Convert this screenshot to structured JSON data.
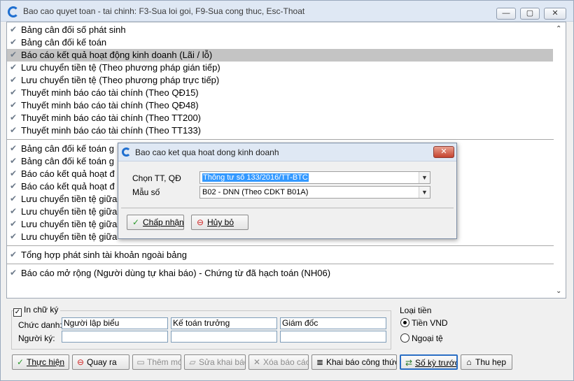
{
  "window": {
    "title": "Bao cao quyet toan - tai chinh: F3-Sua loi goi, F9-Sua cong thuc, Esc-Thoat",
    "min_icon": "minimize-icon",
    "max_icon": "maximize-icon",
    "close_icon": "close-icon"
  },
  "report_list": {
    "group1": [
      "Bảng cân đối số phát sinh",
      "Bảng cân đối kế toán",
      "Báo cáo kết quả hoạt động kinh doanh (Lãi / lỗ)",
      "Lưu chuyển tiền tệ (Theo phương pháp gián tiếp)",
      "Lưu chuyển tiền tệ (Theo phương pháp trực tiếp)",
      "Thuyết minh báo cáo tài chính (Theo QĐ15)",
      "Thuyết minh báo cáo tài chính (Theo QĐ48)",
      "Thuyết minh báo cáo tài chính (Theo TT200)",
      "Thuyết minh báo cáo tài chính (Theo TT133)"
    ],
    "group2": [
      "Bảng cân đối kế toán g",
      "Bảng cân đối kế toán g",
      "Báo cáo kết quả hoạt đ",
      "Báo cáo kết quả hoạt đ",
      "Lưu chuyển tiền tệ giữa",
      "Lưu chuyển tiền tệ giữa",
      "Lưu chuyển tiền tệ giữa",
      "Lưu chuyển tiền tệ giữa"
    ],
    "group3": [
      "Tổng hợp phát sinh tài khoản ngoài bảng"
    ],
    "group4": [
      "Báo cáo mở rộng (Người dùng tự khai báo) - Chứng từ đã hạch toán (NH06)"
    ],
    "selected_index": 2
  },
  "dialog": {
    "title": "Bao cao ket qua hoat dong kinh doanh",
    "circular_label": "Chọn TT, QĐ",
    "circular_value": "Thông tư số 133/2016/TT-BTC",
    "form_label": "Mẫu số",
    "form_value": "B02 - DNN (Theo CDKT B01A)",
    "accept_label": "Chấp nhận",
    "cancel_label": "Hủy bỏ"
  },
  "signature": {
    "checkbox_label": "In chữ ký",
    "checked": true,
    "title_label": "Chức danh:",
    "signer_label": "Người ký:",
    "titles": [
      "Người lập biểu",
      "Kế toán trưởng",
      "Giám đốc"
    ],
    "signers": [
      "",
      "",
      ""
    ]
  },
  "currency": {
    "label": "Loại tiền",
    "options": [
      "Tiền VND",
      "Ngoại tệ"
    ],
    "selected": "Tiền VND"
  },
  "toolbar": {
    "run": "Thực hiện",
    "back": "Quay ra",
    "add": "Thêm mới",
    "edit": "Sửa khai báo",
    "delete": "Xóa báo cáo",
    "declare": "Khai báo công thức",
    "prev_period": "Số kỳ trước",
    "collapse": "Thu hẹp"
  },
  "colors": {
    "selection": "#c4c4c4",
    "highlight": "#3399ff",
    "titlebar": "#dfe8f4",
    "close_red": "#c4432f",
    "accent_blue": "#1f6fd0"
  }
}
